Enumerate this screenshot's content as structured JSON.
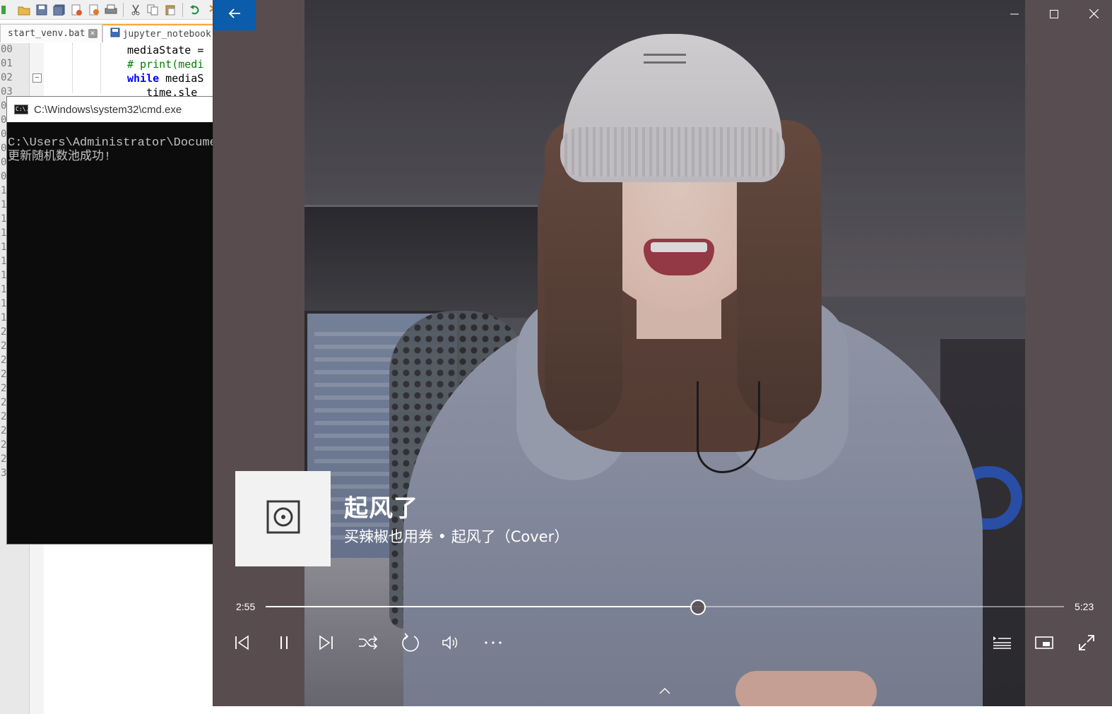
{
  "editor": {
    "tabs": [
      {
        "label": "start_venv.bat",
        "active": false
      },
      {
        "label": "jupyter_notebook",
        "active": true
      }
    ],
    "line_numbers_top": [
      "00",
      "01",
      "02",
      "03"
    ],
    "gutter_fragments": [
      "0",
      "0",
      "0",
      "0",
      "0",
      "0",
      "1",
      "1",
      "1",
      "1",
      "1",
      "1",
      "1",
      "1",
      "1",
      "1",
      "2",
      "2",
      "2",
      "2",
      "2",
      "2",
      "2",
      "2",
      "2",
      "2",
      "3"
    ],
    "code_lines": [
      {
        "text": "mediaState =",
        "kind": "plain"
      },
      {
        "text": "# print(medi",
        "kind": "comment"
      },
      {
        "keyword": "while",
        "text": " mediaS",
        "kind": "keyword"
      },
      {
        "text": "   time.sle",
        "kind": "plain"
      }
    ]
  },
  "cmd": {
    "title": "C:\\Windows\\system32\\cmd.exe",
    "icon_text": "C:\\.",
    "lines": [
      "C:\\Users\\Administrator\\Documen",
      "更新随机数池成功!"
    ]
  },
  "player": {
    "back_icon": "arrow-left-icon",
    "window_controls": [
      "minimize-icon",
      "maximize-icon",
      "close-icon"
    ],
    "now_playing": {
      "title": "起风了",
      "subtitle": "买辣椒也用券 • 起风了（Cover）",
      "album_art_icon": "music-disc-icon"
    },
    "seek": {
      "current": "2:55",
      "total": "5:23",
      "progress": 0.5418
    },
    "controls": [
      {
        "name": "previous-button",
        "icon": "skip-previous-icon"
      },
      {
        "name": "pause-button",
        "icon": "pause-icon"
      },
      {
        "name": "next-button",
        "icon": "skip-next-icon"
      },
      {
        "name": "shuffle-button",
        "icon": "shuffle-icon"
      },
      {
        "name": "repeat-button",
        "icon": "repeat-icon"
      },
      {
        "name": "volume-button",
        "icon": "volume-icon"
      },
      {
        "name": "more-button",
        "icon": "more-dots-icon"
      },
      {
        "name": "playlist-button",
        "icon": "playlist-icon"
      },
      {
        "name": "mini-view-button",
        "icon": "mini-view-icon"
      },
      {
        "name": "fullscreen-button",
        "icon": "fullscreen-icon"
      }
    ],
    "accent": "#0b5cab",
    "background": "#5a4f52"
  }
}
